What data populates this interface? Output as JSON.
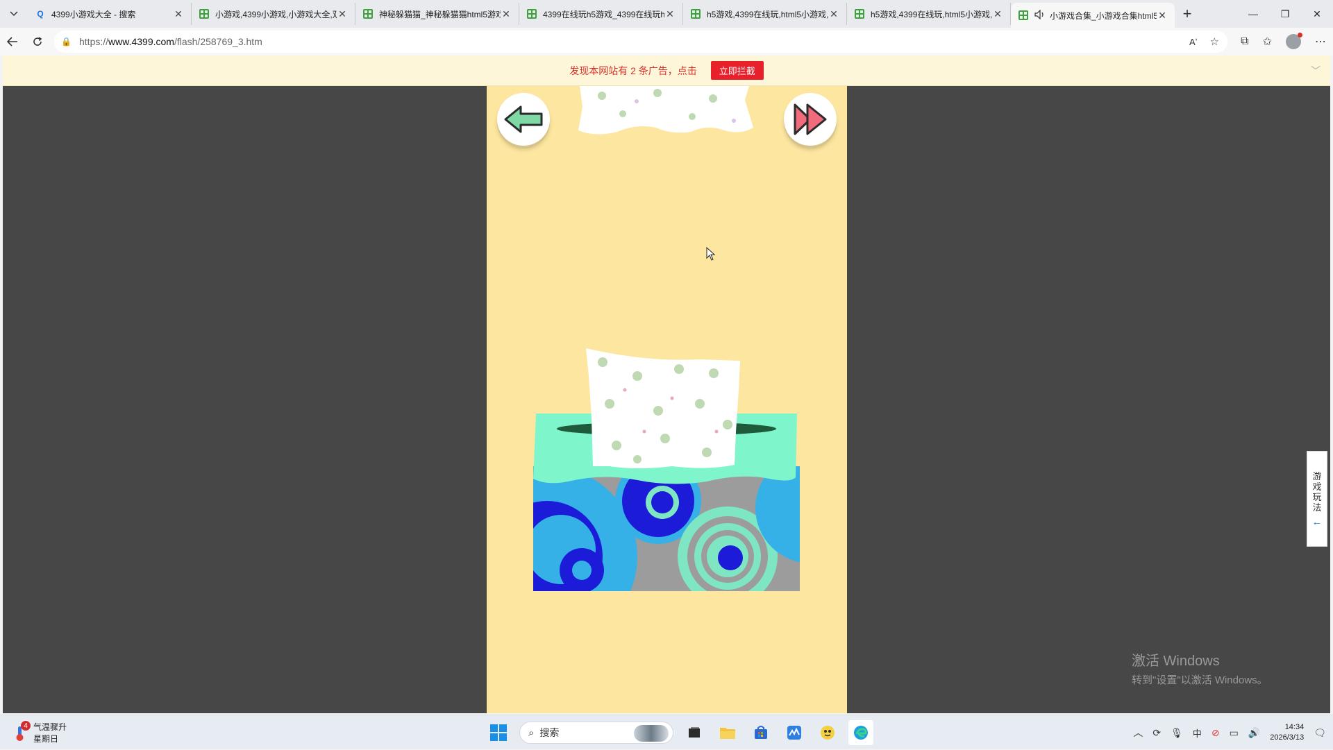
{
  "browser": {
    "tabs": [
      {
        "title": "4399小游戏大全 - 搜索",
        "icon": "search-favicon",
        "active": false
      },
      {
        "title": "小游戏,4399小游戏,小游戏大全,双",
        "icon": "4399-favicon",
        "active": false
      },
      {
        "title": "神秘躲猫猫_神秘躲猫猫html5游戏",
        "icon": "4399-favicon",
        "active": false
      },
      {
        "title": "4399在线玩h5游戏_4399在线玩h5",
        "icon": "4399-favicon",
        "active": false
      },
      {
        "title": "h5游戏,4399在线玩,html5小游戏,",
        "icon": "4399-favicon",
        "active": false
      },
      {
        "title": "h5游戏,4399在线玩,html5小游戏,",
        "icon": "4399-favicon",
        "active": false
      },
      {
        "title": "小游戏合集_小游戏合集html5",
        "icon": "4399-favicon",
        "active": true
      }
    ],
    "url_prefix": "https://",
    "url_host": "www.4399.com",
    "url_path": "/flash/258769_3.htm"
  },
  "adbar": {
    "message": "发现本网站有 2 条广告，点击",
    "button": "立即拦截"
  },
  "game": {
    "background": "#fde69f",
    "back_button_icon": "green-back-arrow-icon",
    "skip_button_icon": "red-fast-forward-icon",
    "scene": "tissue-box"
  },
  "sidepanel": {
    "chars": [
      "游",
      "戏",
      "玩",
      "法"
    ],
    "arrow": "←"
  },
  "watermark": {
    "line1": "激活 Windows",
    "line2": "转到\"设置\"以激活 Windows。"
  },
  "taskbar": {
    "weather_badge": "4",
    "weather_line1": "气温骤升",
    "weather_line2": "星期日",
    "search_placeholder": "搜索",
    "time": "14:34",
    "date": "2026/3/13"
  }
}
